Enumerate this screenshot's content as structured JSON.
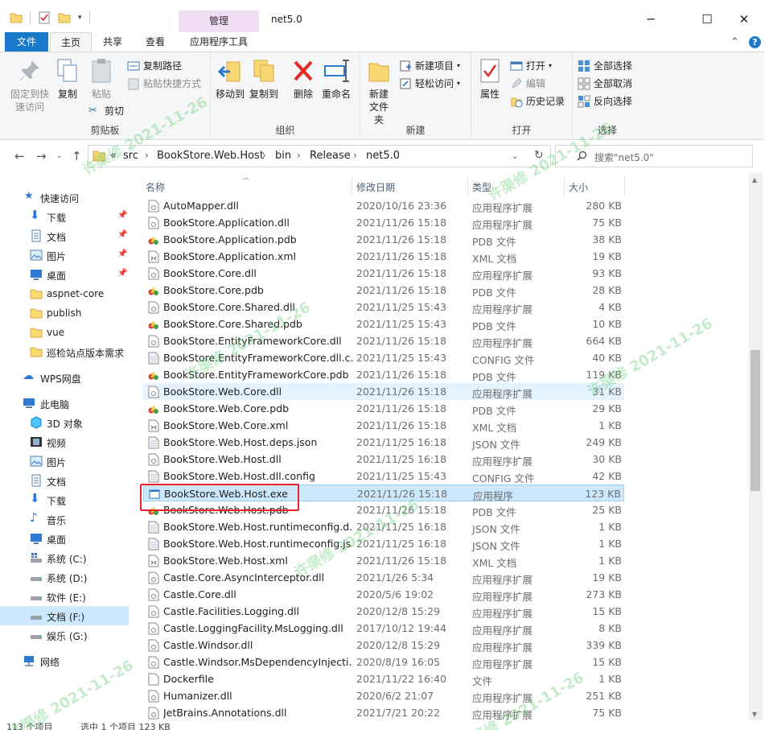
{
  "window": {
    "title": "net5.0",
    "manage_tab": "管理",
    "minimize": "─",
    "maximize": "☐",
    "close": "✕"
  },
  "tabs": {
    "file": "文件",
    "home": "主页",
    "share": "共享",
    "view": "查看",
    "app_tools": "应用程序工具"
  },
  "ribbon": {
    "clipboard": {
      "label": "剪贴板",
      "pin": "固定到快速访问",
      "copy": "复制",
      "paste": "粘贴",
      "copy_path": "复制路径",
      "paste_shortcut": "粘贴快捷方式",
      "cut": "剪切"
    },
    "organize": {
      "label": "组织",
      "move_to": "移动到",
      "copy_to": "复制到",
      "delete": "删除",
      "rename": "重命名"
    },
    "new": {
      "label": "新建",
      "new_folder": "新建文件夹",
      "new_item": "新建项目",
      "easy_access": "轻松访问"
    },
    "open": {
      "label": "打开",
      "properties": "属性",
      "open": "打开",
      "edit": "编辑",
      "history": "历史记录"
    },
    "select": {
      "label": "选择",
      "select_all": "全部选择",
      "select_none": "全部取消",
      "invert": "反向选择"
    }
  },
  "address": {
    "crumbs": [
      "«",
      "src",
      "BookStore.Web.Host",
      "bin",
      "Release",
      "net5.0"
    ],
    "search_placeholder": "搜索\"net5.0\""
  },
  "columns": {
    "name": "名称",
    "date": "修改日期",
    "type": "类型",
    "size": "大小"
  },
  "nav": {
    "quick_access": "快速访问",
    "downloads": "下载",
    "documents": "文档",
    "pictures": "图片",
    "desktop": "桌面",
    "aspnet": "aspnet-core",
    "publish": "publish",
    "vue": "vue",
    "patrol": "巡检站点版本需求",
    "wps": "WPS网盘",
    "this_pc": "此电脑",
    "objects3d": "3D 对象",
    "videos": "视频",
    "pictures2": "图片",
    "documents2": "文档",
    "downloads2": "下载",
    "music": "音乐",
    "desktop2": "桌面",
    "drive_c": "系统 (C:)",
    "drive_d": "系统 (D:)",
    "drive_e": "软件 (E:)",
    "drive_f": "文档 (F:)",
    "drive_g": "娱乐 (G:)",
    "network": "网络"
  },
  "files": [
    {
      "name": "AutoMapper.dll",
      "date": "2020/10/16 23:36",
      "type": "应用程序扩展",
      "size": "280 KB",
      "icon": "dll"
    },
    {
      "name": "BookStore.Application.dll",
      "date": "2021/11/26 15:18",
      "type": "应用程序扩展",
      "size": "75 KB",
      "icon": "dll"
    },
    {
      "name": "BookStore.Application.pdb",
      "date": "2021/11/26 15:18",
      "type": "PDB 文件",
      "size": "38 KB",
      "icon": "pdb"
    },
    {
      "name": "BookStore.Application.xml",
      "date": "2021/11/26 15:18",
      "type": "XML 文档",
      "size": "19 KB",
      "icon": "xml"
    },
    {
      "name": "BookStore.Core.dll",
      "date": "2021/11/26 15:18",
      "type": "应用程序扩展",
      "size": "93 KB",
      "icon": "dll"
    },
    {
      "name": "BookStore.Core.pdb",
      "date": "2021/11/26 15:18",
      "type": "PDB 文件",
      "size": "28 KB",
      "icon": "pdb"
    },
    {
      "name": "BookStore.Core.Shared.dll",
      "date": "2021/11/25 15:43",
      "type": "应用程序扩展",
      "size": "4 KB",
      "icon": "dll"
    },
    {
      "name": "BookStore.Core.Shared.pdb",
      "date": "2021/11/25 15:43",
      "type": "PDB 文件",
      "size": "10 KB",
      "icon": "pdb"
    },
    {
      "name": "BookStore.EntityFrameworkCore.dll",
      "date": "2021/11/26 15:18",
      "type": "应用程序扩展",
      "size": "664 KB",
      "icon": "dll"
    },
    {
      "name": "BookStore.EntityFrameworkCore.dll.c...",
      "date": "2021/11/25 15:43",
      "type": "CONFIG 文件",
      "size": "40 KB",
      "icon": "cfg"
    },
    {
      "name": "BookStore.EntityFrameworkCore.pdb",
      "date": "2021/11/26 15:18",
      "type": "PDB 文件",
      "size": "119 KB",
      "icon": "pdb"
    },
    {
      "name": "BookStore.Web.Core.dll",
      "date": "2021/11/26 15:18",
      "type": "应用程序扩展",
      "size": "31 KB",
      "icon": "dll"
    },
    {
      "name": "BookStore.Web.Core.pdb",
      "date": "2021/11/26 15:18",
      "type": "PDB 文件",
      "size": "29 KB",
      "icon": "pdb"
    },
    {
      "name": "BookStore.Web.Core.xml",
      "date": "2021/11/26 15:18",
      "type": "XML 文档",
      "size": "1 KB",
      "icon": "xml"
    },
    {
      "name": "BookStore.Web.Host.deps.json",
      "date": "2021/11/25 16:18",
      "type": "JSON 文件",
      "size": "249 KB",
      "icon": "cfg"
    },
    {
      "name": "BookStore.Web.Host.dll",
      "date": "2021/11/25 16:18",
      "type": "应用程序扩展",
      "size": "30 KB",
      "icon": "dll"
    },
    {
      "name": "BookStore.Web.Host.dll.config",
      "date": "2021/11/25 15:43",
      "type": "CONFIG 文件",
      "size": "42 KB",
      "icon": "cfg"
    },
    {
      "name": "BookStore.Web.Host.exe",
      "date": "2021/11/26 15:18",
      "type": "应用程序",
      "size": "123 KB",
      "icon": "exe"
    },
    {
      "name": "BookStore.Web.Host.pdb",
      "date": "2021/11/26 15:18",
      "type": "PDB 文件",
      "size": "25 KB",
      "icon": "pdb"
    },
    {
      "name": "BookStore.Web.Host.runtimeconfig.d...",
      "date": "2021/11/25 16:18",
      "type": "JSON 文件",
      "size": "1 KB",
      "icon": "cfg"
    },
    {
      "name": "BookStore.Web.Host.runtimeconfig.js...",
      "date": "2021/11/25 16:18",
      "type": "JSON 文件",
      "size": "1 KB",
      "icon": "cfg"
    },
    {
      "name": "BookStore.Web.Host.xml",
      "date": "2021/11/26 15:18",
      "type": "XML 文档",
      "size": "1 KB",
      "icon": "xml"
    },
    {
      "name": "Castle.Core.AsyncInterceptor.dll",
      "date": "2021/1/26 5:34",
      "type": "应用程序扩展",
      "size": "19 KB",
      "icon": "dll"
    },
    {
      "name": "Castle.Core.dll",
      "date": "2020/5/6 19:02",
      "type": "应用程序扩展",
      "size": "273 KB",
      "icon": "dll"
    },
    {
      "name": "Castle.Facilities.Logging.dll",
      "date": "2020/12/8 15:29",
      "type": "应用程序扩展",
      "size": "15 KB",
      "icon": "dll"
    },
    {
      "name": "Castle.LoggingFacility.MsLogging.dll",
      "date": "2017/10/12 19:44",
      "type": "应用程序扩展",
      "size": "8 KB",
      "icon": "dll"
    },
    {
      "name": "Castle.Windsor.dll",
      "date": "2020/12/8 15:29",
      "type": "应用程序扩展",
      "size": "339 KB",
      "icon": "dll"
    },
    {
      "name": "Castle.Windsor.MsDependencyInjecti...",
      "date": "2020/8/19 16:05",
      "type": "应用程序扩展",
      "size": "15 KB",
      "icon": "dll"
    },
    {
      "name": "Dockerfile",
      "date": "2021/11/22 16:40",
      "type": "文件",
      "size": "1 KB",
      "icon": "blank"
    },
    {
      "name": "Humanizer.dll",
      "date": "2020/6/2 21:07",
      "type": "应用程序扩展",
      "size": "251 KB",
      "icon": "dll"
    },
    {
      "name": "JetBrains.Annotations.dll",
      "date": "2021/7/21 20:22",
      "type": "应用程序扩展",
      "size": "75 KB",
      "icon": "dll"
    }
  ],
  "status": {
    "count": "113 个项目",
    "selected": "选中 1 个项目  123 KB"
  },
  "watermark": "许渠修 2021-11-26",
  "colors": {
    "accent": "#1979ca",
    "selection": "#cce8ff",
    "highlight_box": "#e8242a",
    "manage_tab": "#f1dcf5"
  }
}
